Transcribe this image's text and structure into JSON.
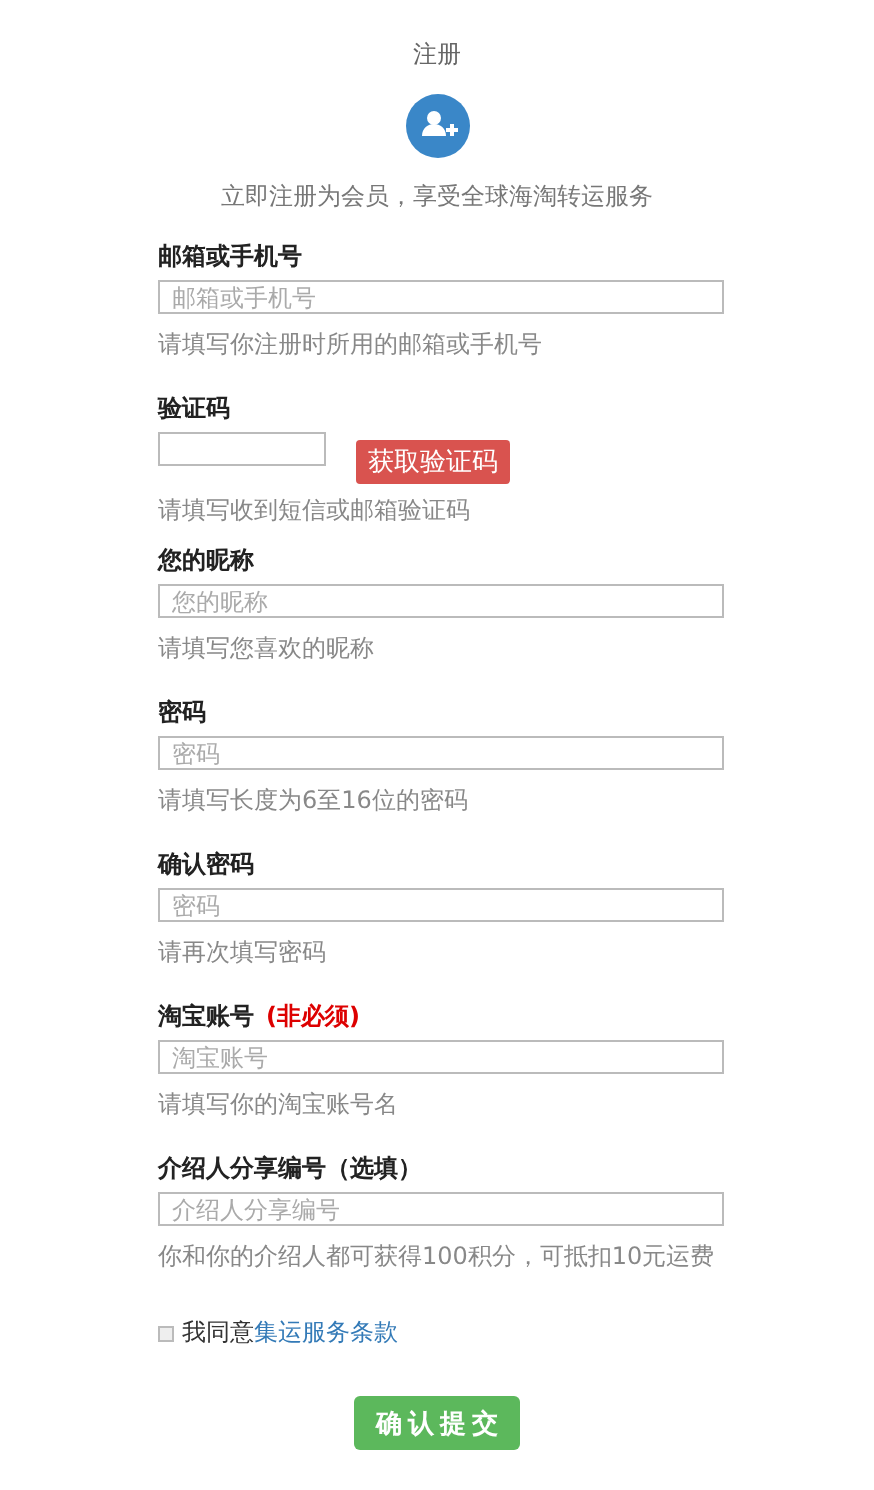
{
  "title": "注册",
  "subtitle": "立即注册为会员，享受全球海淘转运服务",
  "fields": [
    {
      "kind": "text",
      "label": "邮箱或手机号",
      "placeholder": "邮箱或手机号",
      "hint": "请填写你注册时所用的邮箱或手机号"
    },
    {
      "kind": "captcha",
      "label": "验证码",
      "button": "获取验证码",
      "hint": "请填写收到短信或邮箱验证码"
    },
    {
      "kind": "text",
      "label": "您的昵称",
      "placeholder": "您的昵称",
      "hint": "请填写您喜欢的昵称"
    },
    {
      "kind": "text",
      "label": "密码",
      "placeholder": "密码",
      "hint": "请填写长度为6至16位的密码"
    },
    {
      "kind": "text",
      "label": "确认密码",
      "placeholder": "密码",
      "hint": "请再次填写密码"
    },
    {
      "kind": "text",
      "label": "淘宝账号",
      "note": "(非必须)",
      "placeholder": "淘宝账号",
      "hint": "请填写你的淘宝账号名"
    },
    {
      "kind": "text",
      "label": "介绍人分享编号（选填）",
      "placeholder": "介绍人分享编号",
      "hint": "你和你的介绍人都可获得100积分，可抵扣10元运费"
    }
  ],
  "agree": {
    "checked": false,
    "text": "我同意",
    "link": "集运服务条款"
  },
  "submit": "确认提交"
}
